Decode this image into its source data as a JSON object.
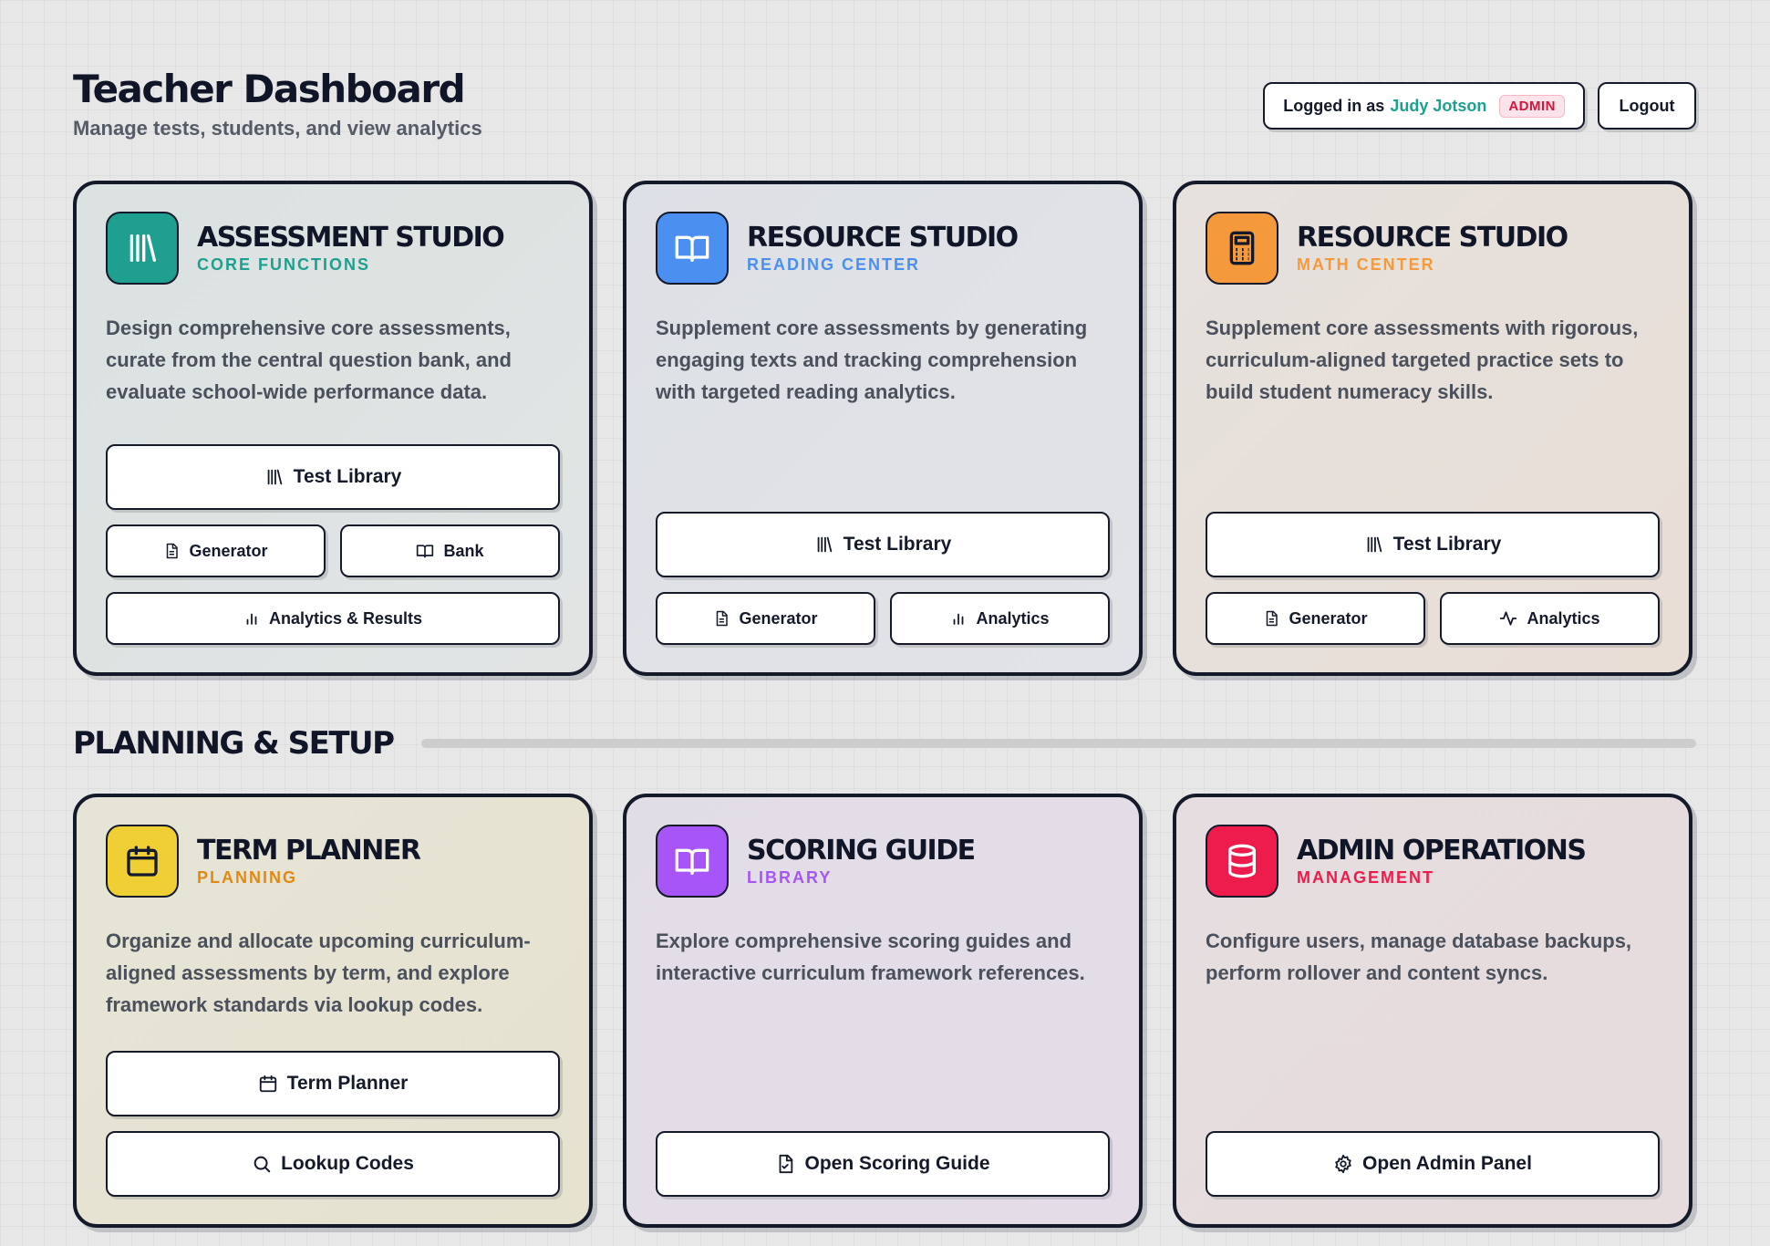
{
  "header": {
    "title": "Teacher Dashboard",
    "subtitle": "Manage tests, students, and view analytics",
    "logged_in_prefix": "Logged in as",
    "user_name": "Judy Jotson",
    "role_badge": "ADMIN",
    "logout_label": "Logout"
  },
  "cards_top": [
    {
      "title": "ASSESSMENT STUDIO",
      "subtitle": "CORE FUNCTIONS",
      "accent": "#1e9f8f",
      "icon": "library-icon",
      "description": "Design comprehensive core assessments, curate from the central question bank, and evaluate school-wide performance data.",
      "buttons": {
        "primary": "Test Library",
        "left": "Generator",
        "right": "Bank",
        "bottom": "Analytics & Results"
      }
    },
    {
      "title": "RESOURCE STUDIO",
      "subtitle": "READING CENTER",
      "accent": "#4b8ff0",
      "icon": "book-open-icon",
      "description": "Supplement core assessments by generating engaging texts and tracking comprehension with targeted reading analytics.",
      "buttons": {
        "primary": "Test Library",
        "left": "Generator",
        "right": "Analytics"
      }
    },
    {
      "title": "RESOURCE STUDIO",
      "subtitle": "MATH CENTER",
      "accent": "#f59a3c",
      "icon": "calculator-icon",
      "description": "Supplement core assessments with rigorous, curriculum-aligned targeted practice sets to build student numeracy skills.",
      "buttons": {
        "primary": "Test Library",
        "left": "Generator",
        "right": "Analytics"
      }
    }
  ],
  "section": {
    "title": "PLANNING & SETUP"
  },
  "cards_bottom": [
    {
      "title": "TERM PLANNER",
      "subtitle": "PLANNING",
      "accent": "#f0cf34",
      "subtitle_color": "#e08a14",
      "icon": "calendar-icon",
      "description": "Organize and allocate upcoming curriculum-aligned assessments by term, and explore framework standards via lookup codes.",
      "buttons": {
        "first": "Term Planner",
        "second": "Lookup Codes"
      }
    },
    {
      "title": "SCORING GUIDE",
      "subtitle": "LIBRARY",
      "accent": "#a855f7",
      "icon": "book-open-icon",
      "description": "Explore comprehensive scoring guides and interactive curriculum framework references.",
      "buttons": {
        "primary": "Open Scoring Guide"
      }
    },
    {
      "title": "ADMIN OPERATIONS",
      "subtitle": "MANAGEMENT",
      "accent": "#ee1c4d",
      "icon": "database-icon",
      "description": "Configure users, manage database backups, perform rollover and content syncs.",
      "buttons": {
        "primary": "Open Admin Panel"
      }
    }
  ]
}
